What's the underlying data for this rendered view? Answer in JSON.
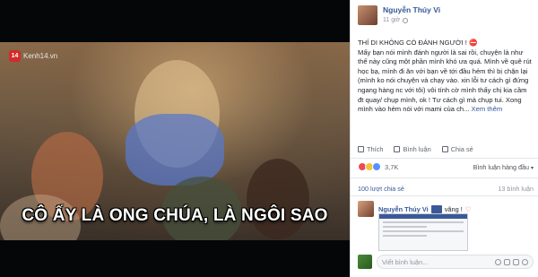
{
  "media": {
    "watermark_badge": "14",
    "watermark_text": "Kenh14.vn",
    "subtitle": "CÔ ẤY LÀ ONG CHÚA, LÀ NGÔI SAO"
  },
  "post": {
    "author": "Nguyễn Thúy Vi",
    "time": "11 giờ",
    "headline": "THÍ DI KHÔNG CÓ ĐÁNH NGƯỜI !",
    "body": "Mấy bạn nói mình đánh người là sai rồi, chuyện là như thế này cũng một phần mình khó ưa quá. Mình về quê rút học bạ, mình đi ăn với bạn về tới đầu hẻm thì bị chặn lại (mình ko nói chuyện và chạy vào. xin lỗi tư cách gì đứng ngang hàng nc với tôi) vôi tính cờ mình thấy chị kia cầm đt quay/ chụp mình, ok ! Tư cách gì mà chụp tui. Xong mình vào hẻm nói với mami của ch...",
    "see_more": "Xem thêm"
  },
  "actions": {
    "like": "Thích",
    "comment": "Bình luận",
    "share": "Chia sẻ"
  },
  "reactions": {
    "count": "3,7K",
    "sort_label": "Bình luận hàng đầu"
  },
  "stats": {
    "shares": "100 lượt chia sẻ",
    "comments": "13 bình luận"
  },
  "comment": {
    "author": "Nguyễn Thúy Vi",
    "text": "vãng !"
  },
  "composer": {
    "placeholder": "Viết bình luận..."
  },
  "colors": {
    "link": "#365899",
    "heart": "#e0245e",
    "media_bg": "#050608"
  }
}
